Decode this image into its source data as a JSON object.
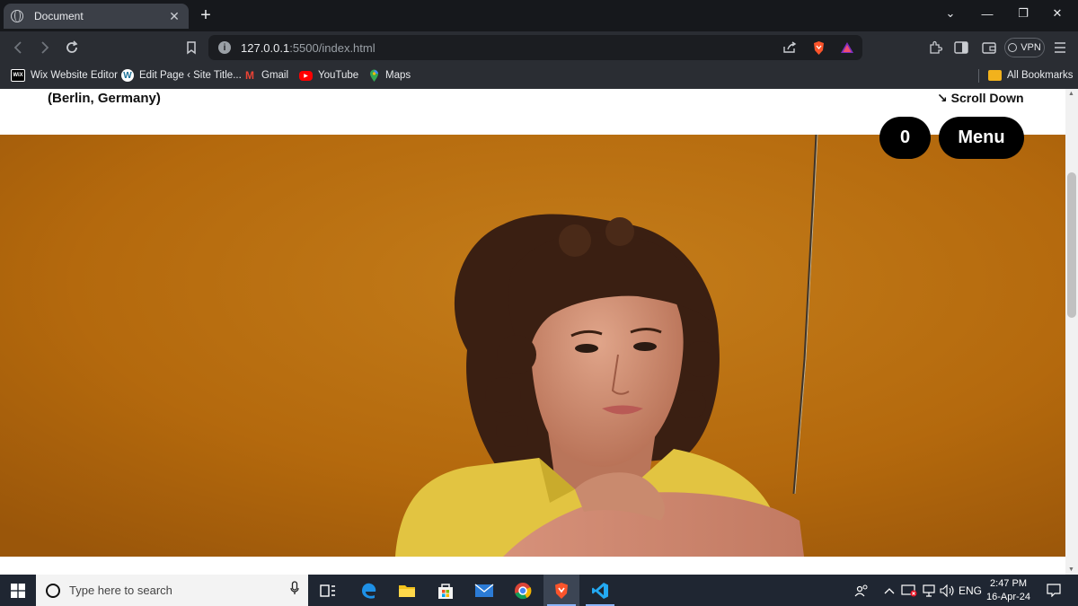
{
  "browser": {
    "tab": {
      "title": "Document",
      "close_glyph": "✕"
    },
    "new_tab_glyph": "+",
    "window_controls": [
      "⌄",
      "—",
      "❐",
      "✕"
    ],
    "address": {
      "host": "127.0.0.1",
      "path": ":5500/index.html"
    },
    "vpn_label": "VPN",
    "bookmarks": [
      {
        "label": "Wix Website Editor",
        "icon": "wix-icon",
        "badge": "WiX",
        "color": "#000000"
      },
      {
        "label": "Edit Page ‹ Site Title...",
        "icon": "wordpress-icon",
        "badge": "W",
        "color": "#21759b"
      },
      {
        "label": "Gmail",
        "icon": "gmail-icon",
        "badge": "M",
        "color": "#ea4335"
      },
      {
        "label": "YouTube",
        "icon": "youtube-icon",
        "badge": "▶",
        "color": "#ff0000"
      },
      {
        "label": "Maps",
        "icon": "maps-icon",
        "badge": "",
        "color": "#34a853"
      }
    ],
    "all_bookmarks": "All Bookmarks"
  },
  "page": {
    "location": "(Berlin, Germany)",
    "scroll_down": "↘ Scroll Down",
    "cart_count": "0",
    "menu_label": "Menu",
    "hero_image": "portrait-of-young-man-with-curly-hair-yellow-shirt"
  },
  "taskbar": {
    "search_placeholder": "Type here to search",
    "language": "ENG",
    "time": "2:47 PM",
    "date": "16-Apr-24"
  },
  "colors": {
    "hero_background": "#b8700f",
    "shirt": "#e4c642",
    "accent": "#000000"
  }
}
